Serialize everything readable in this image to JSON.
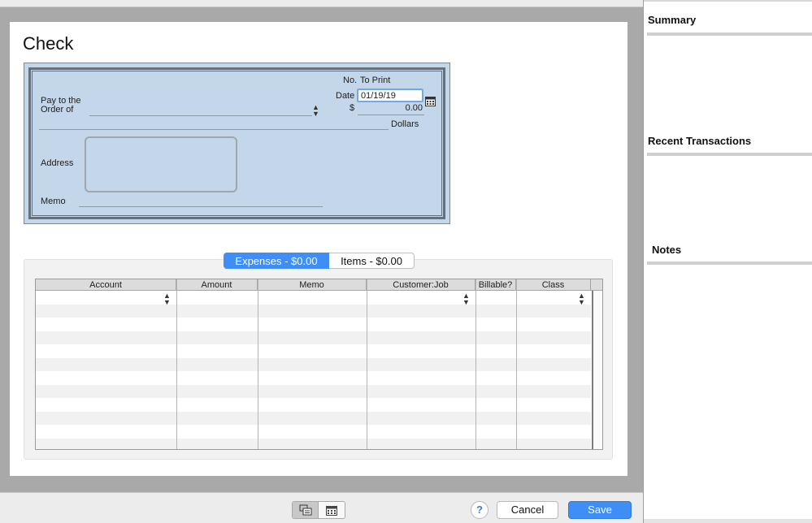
{
  "form": {
    "title": "Check"
  },
  "check": {
    "pay_to_label_1": "Pay to the",
    "pay_to_label_2": "Order of",
    "no_label": "No.",
    "no_value": "To Print",
    "date_label": "Date",
    "date_value": "01/19/19",
    "currency_symbol": "$",
    "amount_value": "0.00",
    "dollars_label": "Dollars",
    "address_label": "Address",
    "memo_label": "Memo"
  },
  "tabs": [
    {
      "label": "Expenses - $0.00",
      "selected": true
    },
    {
      "label": "Items - $0.00",
      "selected": false
    }
  ],
  "table": {
    "columns": [
      "Account",
      "Amount",
      "Memo",
      "Customer:Job",
      "Billable?",
      "Class"
    ],
    "rows": []
  },
  "footer": {
    "help_label": "?",
    "cancel_label": "Cancel",
    "save_label": "Save"
  },
  "sidebar": {
    "summary_title": "Summary",
    "recent_title": "Recent Transactions",
    "notes_title": "Notes"
  },
  "colors": {
    "accent": "#3f8ef5",
    "check_bg": "#c4d7ea"
  }
}
